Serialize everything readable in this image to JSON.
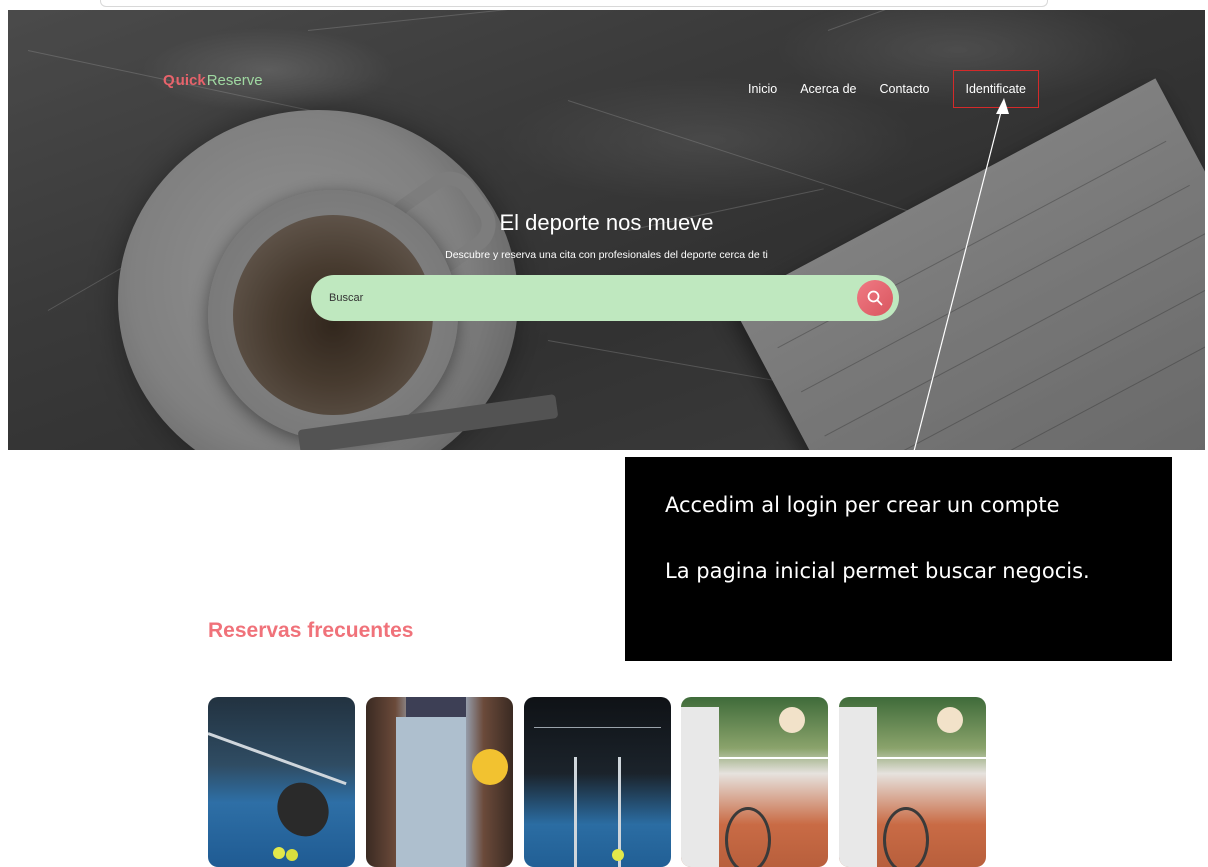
{
  "brand": {
    "name_part1": "uick",
    "name_part2": "Reserve",
    "icon_letter": "Q"
  },
  "nav": {
    "items": [
      {
        "label": "Inicio"
      },
      {
        "label": "Acerca de"
      },
      {
        "label": "Contacto"
      }
    ],
    "login_label": "Identificate"
  },
  "hero": {
    "title": "El deporte nos mueve",
    "subtitle": "Descubre y reserva una cita con profesionales del deporte cerca de ti"
  },
  "search": {
    "placeholder": "Buscar",
    "icon": "search-icon"
  },
  "callout": {
    "line1": "Accedim al login per crear un compte",
    "line2": "La pagina inicial permet buscar negocis."
  },
  "frequent": {
    "title": "Reservas frecuentes",
    "cards": [
      {
        "image": "padel-racket-image"
      },
      {
        "image": "bowling-image"
      },
      {
        "image": "padel-court-image"
      },
      {
        "image": "tennis-image"
      },
      {
        "image": "tennis-image"
      }
    ]
  },
  "colors": {
    "brand_red": "#e8636b",
    "brand_green": "#9fd8a1",
    "search_bg": "#bfe8bf",
    "section_title": "#f0727a",
    "highlight_box": "#d42a2a"
  }
}
